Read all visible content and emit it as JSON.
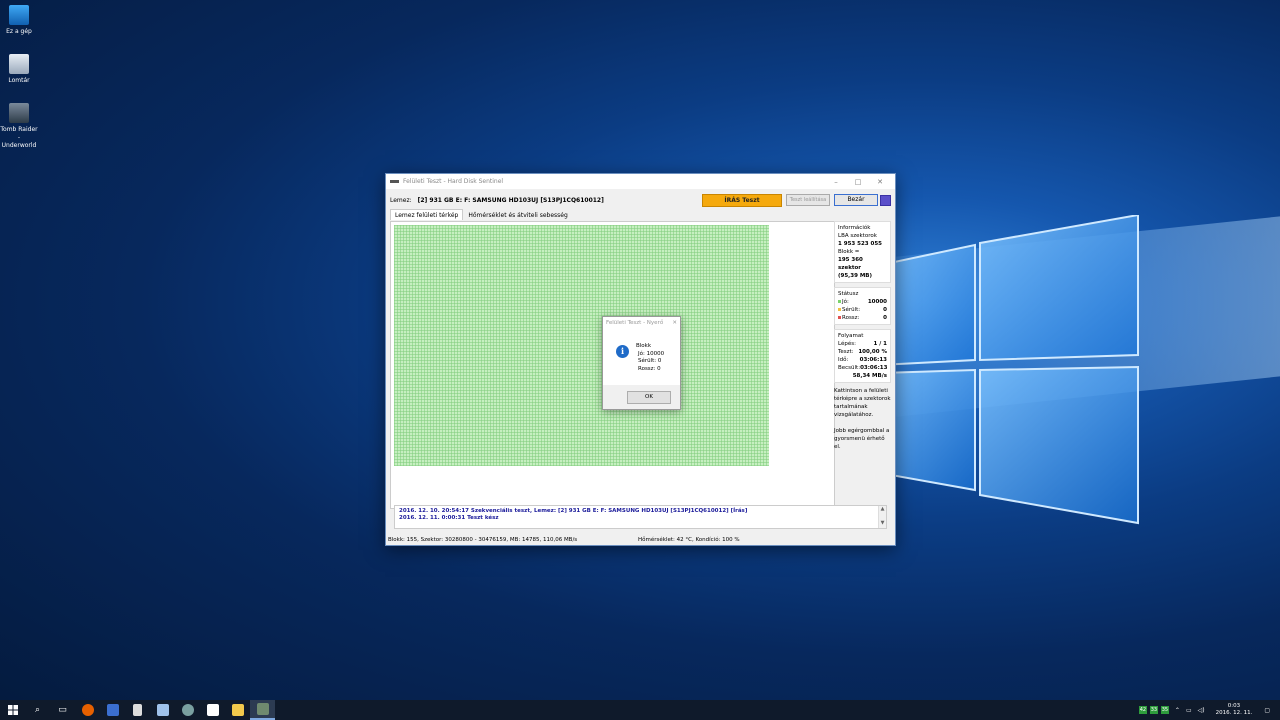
{
  "desktop": {
    "icons": [
      {
        "label": "Ez a gép"
      },
      {
        "label": "Lomtár"
      },
      {
        "label": "Tomb Raider - Underworld"
      }
    ]
  },
  "window": {
    "title": "Felületi Teszt - Hard Disk Sentinel",
    "disk_label": "Lemez:",
    "disk_value": "[2] 931 GB E: F: SAMSUNG HD103UJ [S13PJ1CQ610012]",
    "write_test_label": "ÍRÁS Teszt",
    "stop_label": "Teszt leállítása",
    "close_label": "Bezár",
    "tabs": [
      {
        "label": "Lemez felületi térkép"
      },
      {
        "label": "Hőmérséklet és átviteli sebesség"
      }
    ],
    "info": {
      "heading": "Információk",
      "lba_label": "LBA szektorok",
      "lba_value": "1 953 523 055",
      "block_label": "Blokk =",
      "block_value": "195 360 szektor",
      "block_mb": "(95,39 MB)"
    },
    "status": {
      "heading": "Státusz",
      "good_label": "Jó:",
      "good_value": "10000",
      "damaged_label": "Sérült:",
      "damaged_value": "0",
      "bad_label": "Rossz:",
      "bad_value": "0"
    },
    "progress": {
      "heading": "Folyamat",
      "step_label": "Lépés:",
      "step_value": "1 / 1",
      "test_label": "Teszt:",
      "test_value": "100,00 %",
      "time_label": "Idő:",
      "time_value": "03:06:13",
      "est_label": "Becsült:",
      "est_value": "03:06:13",
      "speed": "58,34 MB/s"
    },
    "hint1": "Kattintson a felületi térképre a szektorok tartalmának vizsgálatához.",
    "hint2": "Jobb egérgombbal a gyorsmenü érhető el.",
    "log": [
      "2016. 12. 10.  20:54:17   Szekvenciális teszt, Lemez: [2] 931 GB E: F: SAMSUNG HD103UJ [S13PJ1CQ610012] [Írás]",
      "2016. 12. 11.  0:00:31   Teszt kész"
    ],
    "statusbar_left": "Blokk: 155, Szektor: 30280800 - 30476159, MB: 14785, 110,06 MB/s",
    "statusbar_right": "Hőmérséklet: 42  °C,  Kondíció: 100 %"
  },
  "dialog": {
    "title": "Felületi Teszt - Nyerő",
    "heading": "Blokk",
    "line1": "Jó: 10000",
    "line2": "Sérült: 0",
    "line3": "Rossz: 0",
    "ok_label": "OK"
  },
  "taskbar": {
    "tray_badges": [
      "42",
      "33",
      "35"
    ],
    "time": "0:03",
    "date": "2016. 12. 11."
  },
  "colors": {
    "accent_orange": "#f5a90d",
    "map_green": "#c6efc0",
    "info_blue": "#1f6bc8"
  }
}
